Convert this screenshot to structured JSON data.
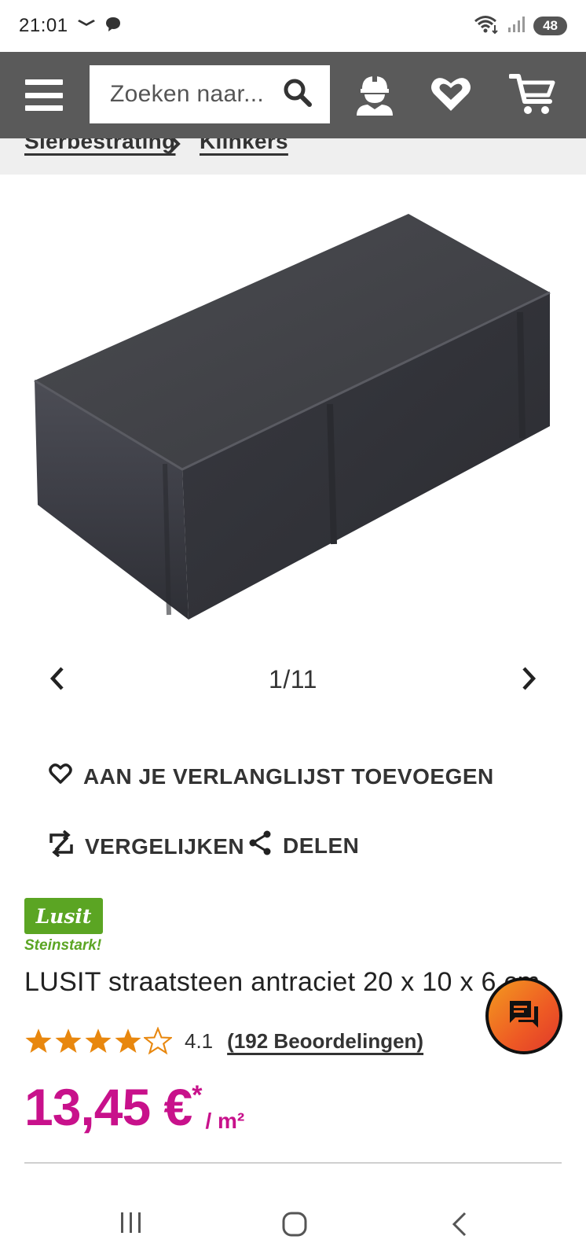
{
  "status_bar": {
    "time": "21:01",
    "battery": "48",
    "icons": [
      "delivery-icon",
      "chat-bubble-icon",
      "wifi-icon",
      "signal-icon"
    ]
  },
  "header": {
    "search_placeholder": "Zoeken naar...",
    "icons": [
      "menu-icon",
      "search-icon",
      "account-icon",
      "wishlist-icon",
      "cart-icon"
    ],
    "background": "#5a5a5a"
  },
  "breadcrumb": {
    "items": [
      "Sierbestrating",
      "Klinkers"
    ]
  },
  "gallery": {
    "counter": "1/11",
    "image": "paving-stone-anthracite"
  },
  "actions": {
    "wishlist": "AAN JE VERLANGLIJST TOEVOEGEN",
    "compare": "VERGELIJKEN",
    "share": "DELEN"
  },
  "brand": {
    "logo_text": "Lusit",
    "tagline": "Steinstark!",
    "color": "#5ba523"
  },
  "product": {
    "title": "LUSIT straatsteen antraciet 20 x 10 x 6 cm",
    "rating": {
      "value": "4.1",
      "reviews": "(192 Beoordelingen)",
      "stars": 4.1
    },
    "price": {
      "amount": "13,45 €",
      "asterisk": "*",
      "unit": "/ m²",
      "color": "#c8118b"
    }
  },
  "chat_button": {
    "icon": "chat-icon"
  },
  "system_nav": {
    "icons": [
      "recent-apps-icon",
      "home-icon",
      "back-icon"
    ]
  }
}
